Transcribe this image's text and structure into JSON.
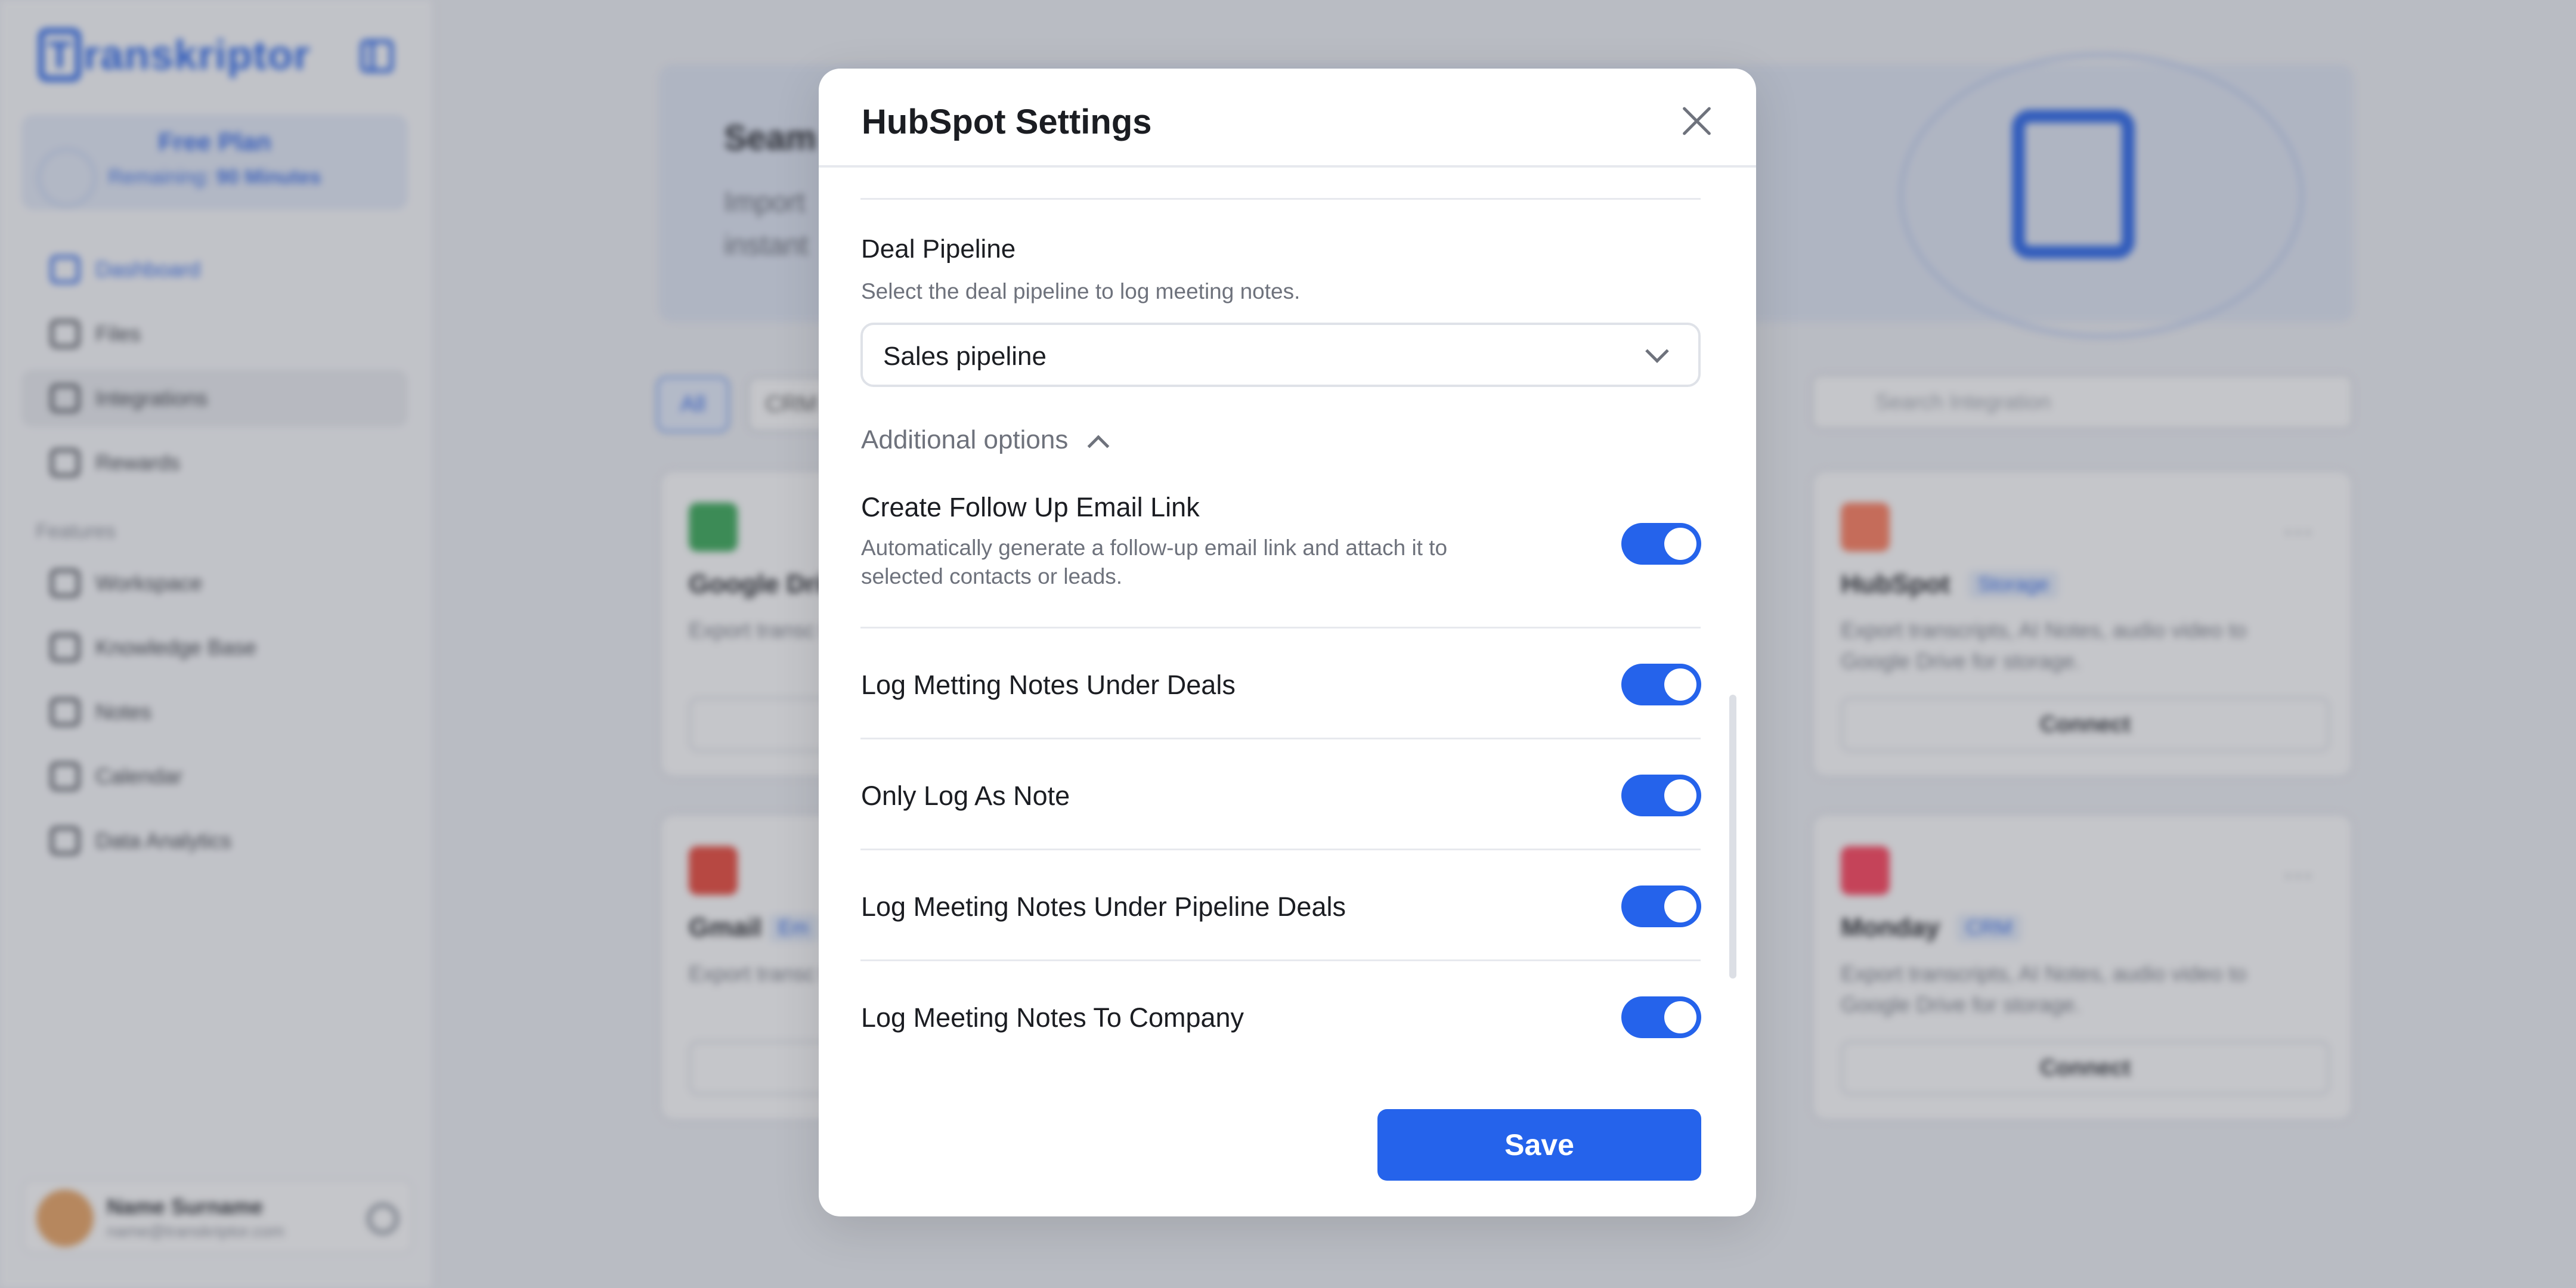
{
  "app": {
    "logo_text": "ranskriptor",
    "logo_mark": "T",
    "plan": {
      "title": "Free Plan",
      "remaining_label": "Remaining:",
      "remaining_value": "90 Minutes"
    },
    "nav": [
      {
        "label": "Dashboard",
        "icon": "dashboard-icon"
      },
      {
        "label": "Files",
        "icon": "file-icon"
      },
      {
        "label": "Integrations",
        "icon": "integrations-icon"
      },
      {
        "label": "Rewards",
        "icon": "gift-icon"
      }
    ],
    "features_label": "Features",
    "features": [
      {
        "label": "Workspace",
        "icon": "users-icon"
      },
      {
        "label": "Knowledge Base",
        "icon": "chat-icon"
      },
      {
        "label": "Notes",
        "icon": "notes-icon"
      },
      {
        "label": "Calendar",
        "icon": "calendar-icon"
      },
      {
        "label": "Data Analytics",
        "icon": "analytics-icon"
      }
    ],
    "user": {
      "name": "Name Surname",
      "email": "name@transkriptor.com"
    }
  },
  "main": {
    "banner": {
      "title": "Seam",
      "text_line1": "Import",
      "text_line2": "instant"
    },
    "filters": [
      "All",
      "CRM"
    ],
    "search_placeholder": "Search Integration",
    "cards": [
      {
        "name": "Google Driv",
        "tag": "",
        "desc": "Export transc to Google Driv",
        "button": "",
        "icon_color": "#34a853"
      },
      {
        "name": "HubSpot",
        "tag": "Storage",
        "desc": "Export transcripts, AI Notes, audio video to Google Drive for storage.",
        "button": "Connect",
        "icon_color": "#ff7a59"
      },
      {
        "name": "Gmail",
        "tag": "Em",
        "desc": "Export transc to Google Driv",
        "button": "",
        "icon_color": "#ea4335"
      },
      {
        "name": "Monday",
        "tag": "CRM",
        "desc": "Export transcripts, AI Notes, audio video to Google Drive for storage.",
        "button": "Connect",
        "icon_color": "#ff3d57"
      }
    ]
  },
  "modal": {
    "title": "HubSpot Settings",
    "deal_pipeline": {
      "label": "Deal Pipeline",
      "description": "Select the deal pipeline to log meeting notes.",
      "selected": "Sales pipeline"
    },
    "additional_options": "Additional options",
    "options": [
      {
        "label": "Create Follow Up Email Link",
        "description_line1": "Automatically generate a follow-up email link and attach it to",
        "description_line2": "selected contacts or leads.",
        "enabled": true
      },
      {
        "label": "Log Metting Notes Under Deals",
        "enabled": true
      },
      {
        "label": "Only Log As Note",
        "enabled": true
      },
      {
        "label": "Log Meeting Notes Under Pipeline Deals",
        "enabled": true
      },
      {
        "label": "Log Meeting Notes To Company",
        "enabled": true
      }
    ],
    "save_label": "Save",
    "accent": "#2563eb"
  }
}
